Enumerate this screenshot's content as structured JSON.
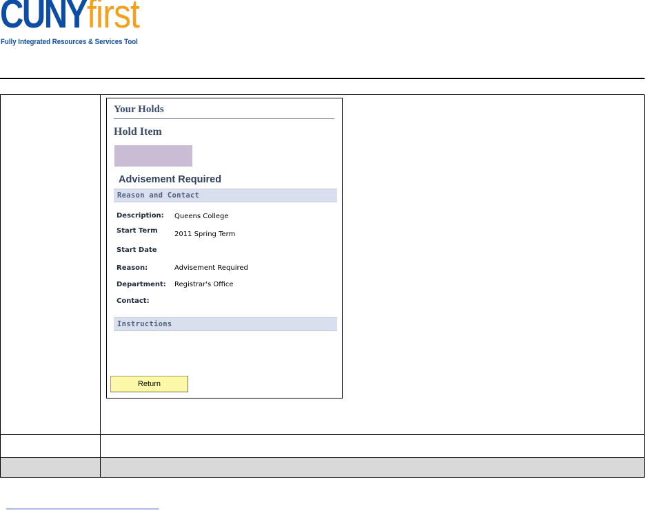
{
  "logo": {
    "brand_main": "CUNY",
    "brand_accent": "first",
    "tagline": "Fully Integrated Resources & Services Tool",
    "colors": {
      "main": "#0e4da4",
      "accent": "#f4a01c"
    }
  },
  "screenshot": {
    "heading": "Your Holds",
    "subheading": "Hold Item",
    "hold_title": "Advisement Required",
    "sections": {
      "reason_contact": "Reason and Contact",
      "instructions": "Instructions"
    },
    "fields": {
      "description": {
        "label": "Description:",
        "value": "Queens College"
      },
      "start_term": {
        "label": "Start Term",
        "value": "2011 Spring Term"
      },
      "start_date": {
        "label": "Start Date",
        "value": ""
      },
      "reason": {
        "label": "Reason:",
        "value": "Advisement Required"
      },
      "department": {
        "label": "Department:",
        "value": "Registrar's Office"
      },
      "contact": {
        "label": "Contact:",
        "value": ""
      }
    },
    "return_button": "Return",
    "colors": {
      "heading": "#3d4c6a",
      "section_bar": "#d9dfed",
      "hold_swatch": "#cbbcd6",
      "button": "#fdf7a8"
    }
  }
}
